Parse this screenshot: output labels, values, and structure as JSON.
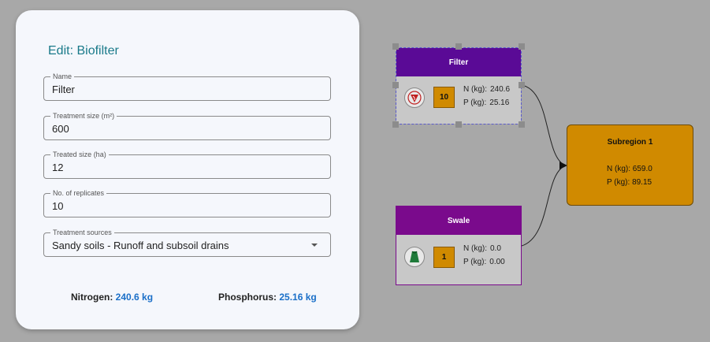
{
  "editor": {
    "title": "Edit: Biofilter",
    "fields": {
      "name": {
        "label": "Name",
        "value": "Filter"
      },
      "treatment_size": {
        "label": "Treatment size (m²)",
        "value": "600"
      },
      "treated_size": {
        "label": "Treated size (ha)",
        "value": "12"
      },
      "replicates": {
        "label": "No. of replicates",
        "value": "10"
      },
      "sources": {
        "label": "Treatment sources",
        "value": "Sandy soils - Runoff and subsoil drains"
      }
    },
    "summary": {
      "nitrogen_label": "Nitrogen:",
      "nitrogen_value": "240.6 kg",
      "phosphorus_label": "Phosphorus:",
      "phosphorus_value": "25.16 kg"
    }
  },
  "graph": {
    "filter": {
      "title": "Filter",
      "count": "10",
      "n_label": "N (kg):",
      "n_value": "240.6",
      "p_label": "P (kg):",
      "p_value": "25.16",
      "color": "#5a0a96",
      "icon": "biofilter-icon"
    },
    "swale": {
      "title": "Swale",
      "count": "1",
      "n_label": "N (kg):",
      "n_value": "0.0",
      "p_label": "P (kg):",
      "p_value": "0.00",
      "color": "#7a0a8c",
      "icon": "swale-icon"
    },
    "subregion": {
      "title": "Subregion 1",
      "n_label": "N (kg):",
      "n_value": "659.0",
      "p_label": "P (kg):",
      "p_value": "89.15",
      "color": "#d08a00"
    }
  }
}
